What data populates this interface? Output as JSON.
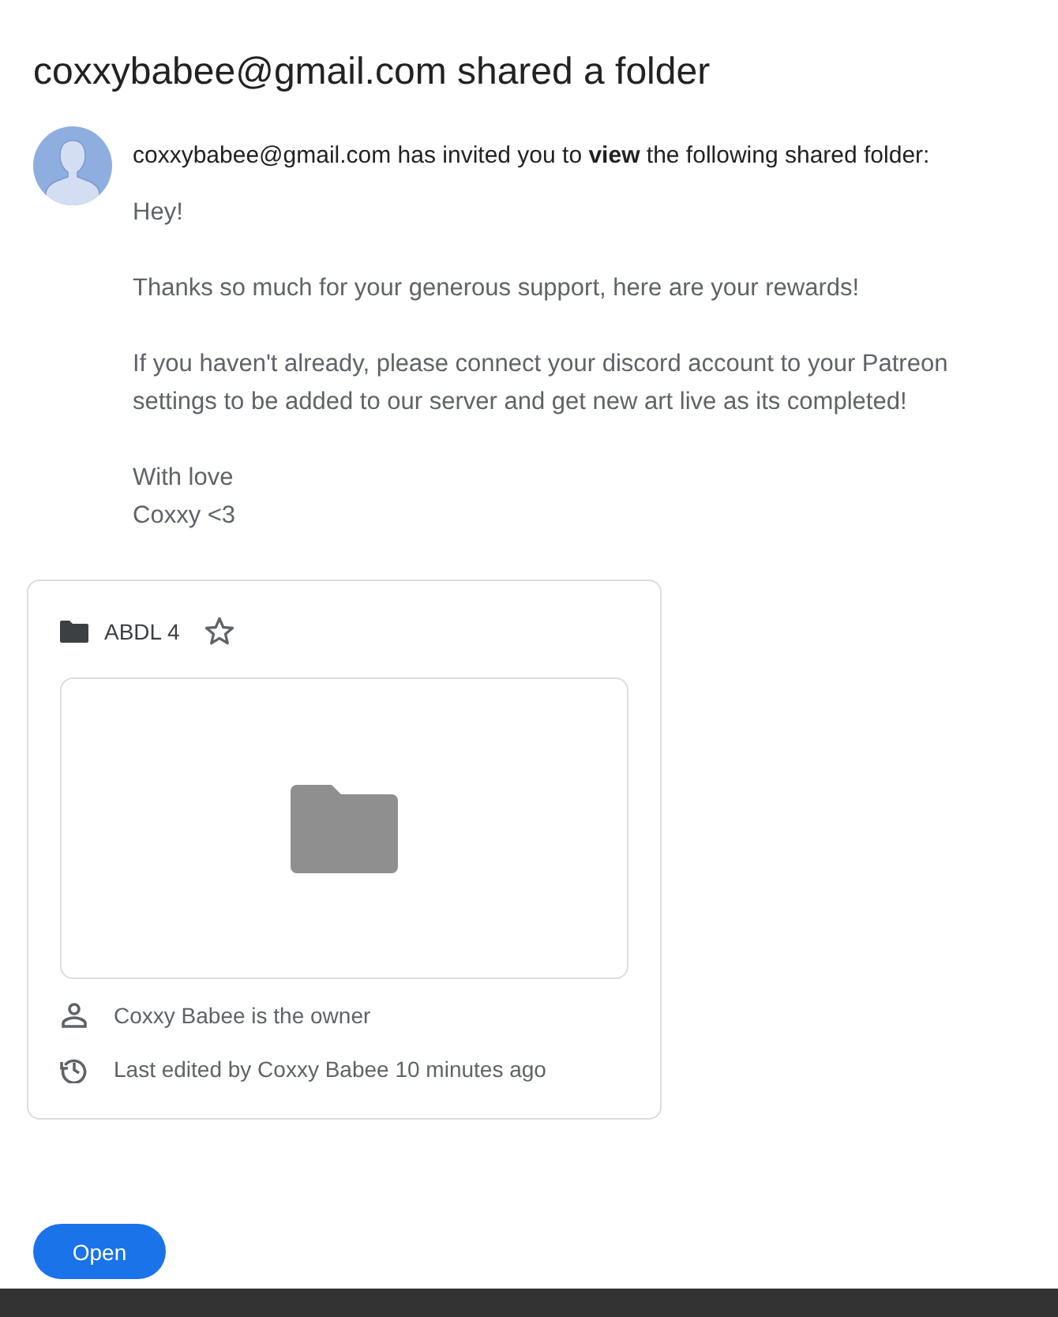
{
  "title": "coxxybabee@gmail.com shared a folder",
  "invite": "coxxybabee@gmail.com has invited you to **view** the following shared folder:",
  "message": [
    [
      "Hey!"
    ],
    [
      "Thanks so much for your generous support, here are your rewards!"
    ],
    [
      "If you haven't already, please connect your discord account to your Patreon settings to be added to our server and get new art live as its completed!"
    ],
    [
      "With love",
      "Coxxy <3"
    ]
  ],
  "card": {
    "name": "ABDL 4",
    "starred": false,
    "details": [
      {
        "kind": "owner",
        "text": "Coxxy Babee is the owner"
      },
      {
        "kind": "history",
        "text": "Last edited by Coxxy Babee 10 minutes ago"
      }
    ]
  },
  "button": "Open"
}
